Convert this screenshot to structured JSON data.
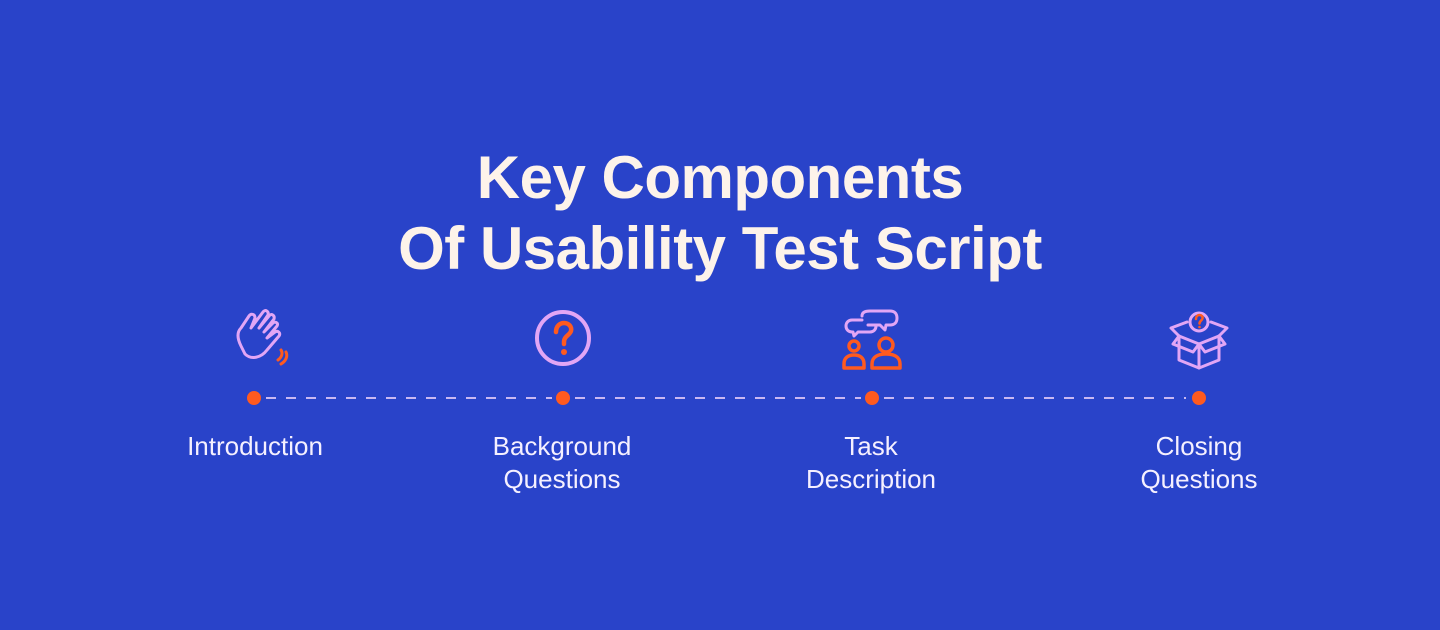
{
  "title": {
    "line1": "Key Components",
    "line2": "Of Usability Test Script"
  },
  "colors": {
    "background": "#2943C9",
    "title_text": "#FDF3EA",
    "label_text": "#F5F0FF",
    "dot": "#FF5A1F",
    "icon_outline": "#E2A6F5",
    "icon_accent": "#FF5A1F",
    "dash": "#C9B8F2"
  },
  "steps": [
    {
      "icon": "waving-hand-icon",
      "label_line1": "Introduction",
      "label_line2": ""
    },
    {
      "icon": "question-circle-icon",
      "label_line1": "Background",
      "label_line2": "Questions"
    },
    {
      "icon": "conversation-people-icon",
      "label_line1": "Task",
      "label_line2": "Description"
    },
    {
      "icon": "open-box-question-icon",
      "label_line1": "Closing",
      "label_line2": "Questions"
    }
  ]
}
